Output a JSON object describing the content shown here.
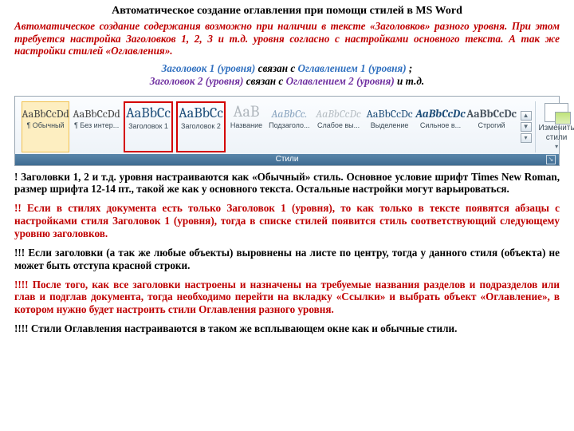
{
  "title": "Автоматическое создание оглавления при помощи стилей в MS Word",
  "intro": "Автоматическое создание содержания возможно при наличии в тексте «Заголовков» разного уровня. При этом требуется настройка Заголовков 1, 2, 3 и т.д. уровня согласно с настройками основного текста. А так же настройки стилей «Оглавления».",
  "map1": {
    "a": "Заголовок 1 (уровня)",
    "mid": " связан с ",
    "b": "Оглавлением 1 (уровня)",
    "end": ";"
  },
  "map2": {
    "a": "Заголовок 2 (уровня)",
    "mid": " связан с ",
    "b": "Оглавлением 2 (уровня)",
    "end": " и т.д."
  },
  "ribbon": {
    "items": [
      {
        "sample": "AaBbCcDd",
        "name": "¶ Обычный"
      },
      {
        "sample": "AaBbCcDd",
        "name": "¶ Без интер..."
      },
      {
        "sample": "AaBbCc",
        "name": "Заголовок 1"
      },
      {
        "sample": "AaBbCc",
        "name": "Заголовок 2"
      },
      {
        "sample": "AaB",
        "name": "Название"
      },
      {
        "sample": "AaBbCc.",
        "name": "Подзаголо..."
      },
      {
        "sample": "AaBbCcDc",
        "name": "Слабое вы..."
      },
      {
        "sample": "AaBbCcDc",
        "name": "Выделение"
      },
      {
        "sample": "AaBbCcDc",
        "name": "Сильное в..."
      },
      {
        "sample": "AaBbCcDc",
        "name": "Строгий"
      }
    ],
    "change": "Изменить стили",
    "group": "Стили"
  },
  "p1": "! Заголовки 1, 2 и т.д. уровня настраиваются как «Обычный» стиль. Основное условие шрифт Times New Roman, размер шрифта 12-14 пт., такой же как у основного текста. Остальные настройки могут варьироваться.",
  "p2": "!! Если в стилях документа есть только Заголовок 1 (уровня), то как только в тексте появятся абзацы с настройками стиля Заголовок 1 (уровня), тогда в списке стилей появится стиль соответствующий следующему уровню заголовков.",
  "p3": "!!! Если заголовки (а так же любые объекты) выровнены на листе по центру, тогда у данного стиля (объекта) не может быть отступа красной строки.",
  "p4": "!!!! После того, как все заголовки настроены и назначены на требуемые названия разделов и подразделов или глав и подглав документа, тогда необходимо перейти на вкладку «Ссылки» и выбрать объект «Оглавление», в котором нужно будет настроить стили Оглавления  разного уровня.",
  "p5": "!!!! Стили Оглавления настраиваются в таком же всплывающем окне как и обычные стили."
}
